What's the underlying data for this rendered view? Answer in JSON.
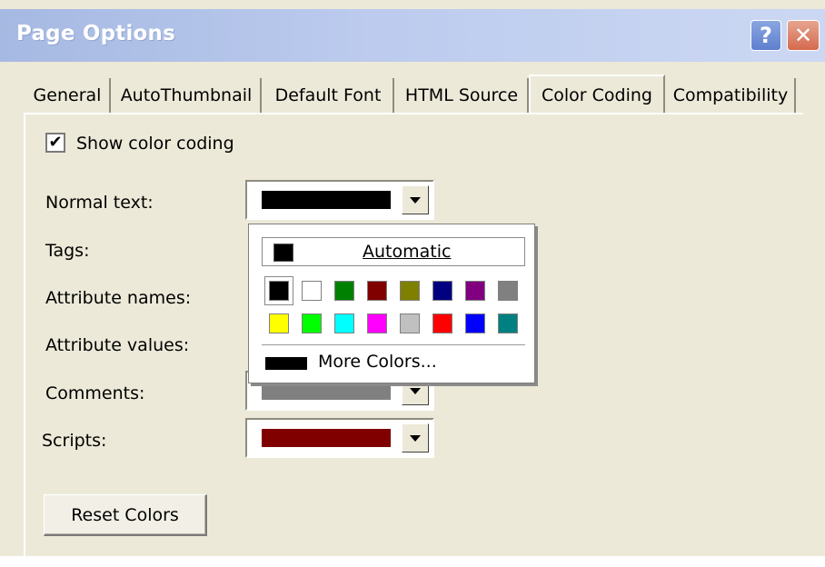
{
  "window": {
    "title": "Page Options"
  },
  "title_buttons": {
    "help_label": "?",
    "close_label": "✕"
  },
  "tabs": [
    {
      "label": "General"
    },
    {
      "label": "AutoThumbnail"
    },
    {
      "label": "Default Font"
    },
    {
      "label": "HTML Source"
    },
    {
      "label": "Color Coding",
      "active": true
    },
    {
      "label": "Compatibility"
    }
  ],
  "show_color_coding": {
    "label": "Show color coding",
    "checked": true,
    "mark": "✔"
  },
  "rows": [
    {
      "label": "Normal text:",
      "color": "#000000"
    },
    {
      "label": "Tags:",
      "color": ""
    },
    {
      "label": "Attribute names:",
      "color": ""
    },
    {
      "label": "Attribute values:",
      "color": ""
    },
    {
      "label": "Comments:",
      "color": "#808080"
    },
    {
      "label": "Scripts:",
      "color": "#800000"
    }
  ],
  "palette": {
    "automatic_label": "Automatic",
    "more_colors_label": "More Colors...",
    "row1": [
      "#000000",
      "#ffffff",
      "#008000",
      "#800000",
      "#808000",
      "#000080",
      "#800080",
      "#808080"
    ],
    "row2": [
      "#ffff00",
      "#00ff00",
      "#00ffff",
      "#ff00ff",
      "#c0c0c0",
      "#ff0000",
      "#0000ff",
      "#008080"
    ]
  },
  "reset_button": {
    "label": "Reset Colors"
  }
}
